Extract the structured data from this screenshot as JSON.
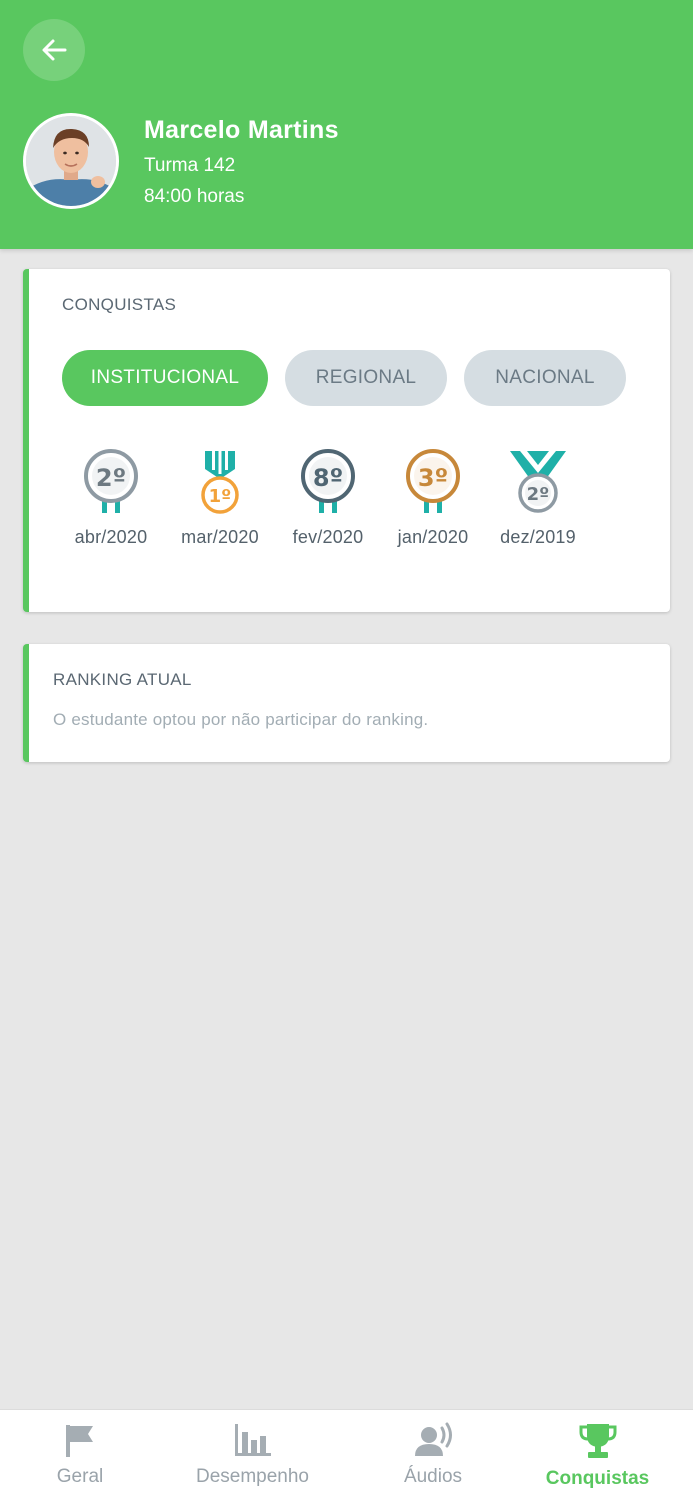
{
  "header": {
    "back_icon": "arrow-left-icon",
    "student": {
      "name": "Marcelo Martins",
      "class": "Turma 142",
      "hours": "84:00 horas"
    }
  },
  "achievements": {
    "title": "CONQUISTAS",
    "tabs": [
      {
        "label": "INSTITUCIONAL",
        "active": true
      },
      {
        "label": "REGIONAL",
        "active": false
      },
      {
        "label": "NACIONAL",
        "active": false
      }
    ],
    "medals": [
      {
        "place": "2º",
        "month": "abr/2020",
        "color": "#8e9aa3"
      },
      {
        "place": "1º",
        "month": "mar/2020",
        "color": "#f2a23a"
      },
      {
        "place": "8º",
        "month": "fev/2020",
        "color": "#506673"
      },
      {
        "place": "3º",
        "month": "jan/2020",
        "color": "#c7883a"
      },
      {
        "place": "2º",
        "month": "dez/2019",
        "color": "#8e9aa3"
      }
    ]
  },
  "ranking": {
    "title": "RANKING ATUAL",
    "message": "O estudante optou por não participar do ranking."
  },
  "nav": {
    "items": [
      {
        "label": "Geral",
        "icon": "flag-icon",
        "active": false
      },
      {
        "label": "Desempenho",
        "icon": "bar-chart-icon",
        "active": false
      },
      {
        "label": "Áudios",
        "icon": "speaking-person-icon",
        "active": false
      },
      {
        "label": "Conquistas",
        "icon": "trophy-icon",
        "active": true
      }
    ]
  },
  "colors": {
    "accent": "#59c75f",
    "ribbon": "#1fb0a8",
    "inactive_tab": "#d5dde2",
    "background": "#e7e7e7"
  }
}
